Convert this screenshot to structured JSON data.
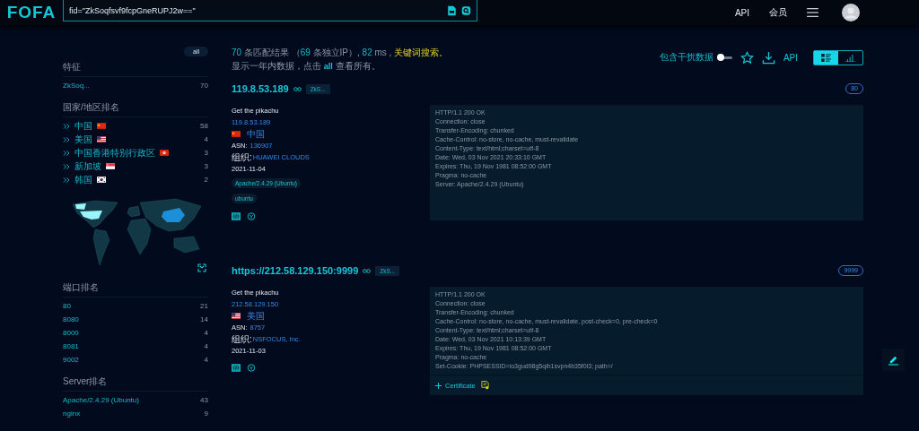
{
  "header": {
    "logo": "FOFA",
    "search": {
      "value": "fid=\"ZkSoqfsvf9fcpGneRUPJ2w==\""
    },
    "nav": [
      "API",
      "会员"
    ]
  },
  "sidebar": {
    "all_button": "all",
    "sections": [
      {
        "title": "特征",
        "kind": "plain",
        "items": [
          {
            "label": "ZkSoq...",
            "count": "70"
          }
        ]
      },
      {
        "title": "国家/地区排名",
        "kind": "country",
        "items": [
          {
            "label": "中国",
            "kind": "cn",
            "count": "58"
          },
          {
            "label": "美国",
            "kind": "us",
            "count": "4"
          },
          {
            "label": "中国香港特别行政区",
            "kind": "hk",
            "count": "3"
          },
          {
            "label": "新加坡",
            "kind": "sg",
            "count": "3"
          },
          {
            "label": "韩国",
            "kind": "kr",
            "count": "2"
          }
        ]
      },
      {
        "title": "端口排名",
        "kind": "plain",
        "items": [
          {
            "label": "80",
            "count": "21"
          },
          {
            "label": "8080",
            "count": "14"
          },
          {
            "label": "8000",
            "count": "4"
          },
          {
            "label": "8081",
            "count": "4"
          },
          {
            "label": "9002",
            "count": "4"
          }
        ]
      },
      {
        "title": "Server排名",
        "kind": "plain",
        "items": [
          {
            "label": "Apache/2.4.29 (Ubuntu)",
            "count": "43"
          },
          {
            "label": "nginx",
            "count": "9"
          }
        ]
      }
    ]
  },
  "summary": [
    {
      "kind": "number",
      "text": "70"
    },
    {
      "kind": "text",
      "text": " 条匹配结果 （"
    },
    {
      "kind": "number",
      "text": "69"
    },
    {
      "kind": "text",
      "text": " 条独立IP）, "
    },
    {
      "kind": "number",
      "text": "82"
    },
    {
      "kind": "text",
      "text": " ms , "
    },
    {
      "kind": "link",
      "text": "关键词搜索。"
    }
  ],
  "notice": [
    {
      "kind": "text",
      "text": "显示一年内数据，点击 "
    },
    {
      "kind": "link",
      "text": "all"
    },
    {
      "kind": "text",
      "text": " 查看所有。"
    }
  ],
  "toolbar": {
    "toggle": {
      "label": "包含干扰数据",
      "on": false
    },
    "api": "API",
    "views": [
      {
        "kind": "list",
        "selected": true
      },
      {
        "kind": "chart",
        "selected": false
      }
    ]
  },
  "results": [
    {
      "host": "119.8.53.189",
      "tag": "ZkS...",
      "port": "80",
      "title": "Get the pikachu",
      "ip": "119.8.53.189",
      "country": "中国",
      "kind": "cn",
      "asn_label": "ASN:",
      "asn": "136907",
      "org_label": "组织:",
      "org": "HUAWEI CLOUDS",
      "date": "2021-11-04",
      "products": [
        "Apache/2.4.29 (Ubuntu)",
        "ubuntu"
      ],
      "banner": [
        "HTTP/1.1 200 OK",
        "Connection: close",
        "Transfer-Encoding: chunked",
        "Cache-Control: no-store, no-cache, must-revalidate",
        "Content-Type: text/html;charset=utf-8",
        "Date: Wed, 03 Nov 2021 20:33:10 GMT",
        "Expires: Thu, 19 Nov 1981 08:52:00 GMT",
        "Pragma: no-cache",
        "Server: Apache/2.4.29 (Ubuntu)"
      ]
    },
    {
      "host": "https://212.58.129.150:9999",
      "tag": "ZkS...",
      "port": "9999",
      "title": "Get the pikachu",
      "ip": "212.58.129.150",
      "country": "美国",
      "kind": "us",
      "asn_label": "ASN:",
      "asn": "8757",
      "org_label": "组织:",
      "org": "NSFOCUS, Inc.",
      "date": "2021-11-03",
      "banner": [
        "HTTP/1.1 200 OK",
        "Connection: close",
        "Transfer-Encoding: chunked",
        "Cache-Control: no-store, no-cache, must-revalidate, post-check=0, pre-check=0",
        "Content-Type: text/html;charset=utf-8",
        "Date: Wed, 03 Nov 2021 10:13:39 GMT",
        "Expires: Thu, 19 Nov 1981 08:52:00 GMT",
        "Pragma: no-cache",
        "Set-Cookie: PHPSESSID=io3gud98g5qih1svpn4b35f0l3; path=/"
      ],
      "certificate": "Certificate"
    }
  ]
}
